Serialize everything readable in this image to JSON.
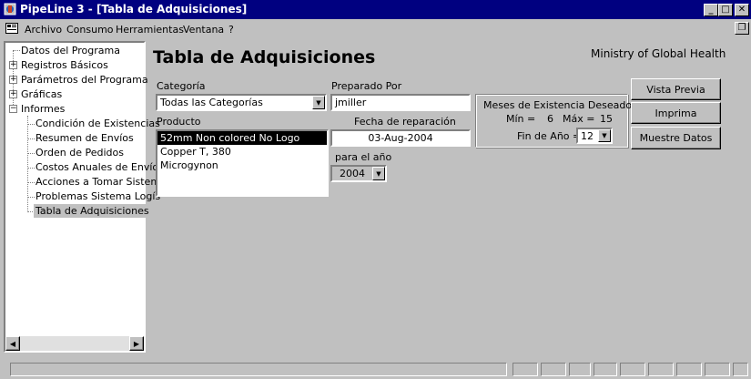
{
  "window": {
    "title": "PipeLine 3 - [Tabla de Adquisiciones]"
  },
  "menu": {
    "items": [
      "Archivo",
      "Consumo",
      "Herramientas",
      "Ventana",
      "?"
    ]
  },
  "tree": {
    "items": [
      {
        "label": "Datos del Programa",
        "expander": ""
      },
      {
        "label": "Registros Básicos",
        "expander": "+"
      },
      {
        "label": "Parámetros del Programa",
        "expander": "+"
      },
      {
        "label": "Gráficas",
        "expander": "+"
      },
      {
        "label": "Informes",
        "expander": "−"
      }
    ],
    "children": [
      "Condición de Existencias",
      "Resumen de Envíos",
      "Orden de Pedidos",
      "Costos Anuales de Envío",
      "Acciones a Tomar Sistema",
      "Problemas Sistema Logís",
      "Tabla de Adquisiciones"
    ],
    "selected_child_index": 6
  },
  "form": {
    "title": "Tabla de Adquisiciones",
    "org": "Ministry of Global Health",
    "category_label": "Categoría",
    "category_value": "Todas las Categorías",
    "prepared_label": "Preparado Por",
    "prepared_value": "jmiller",
    "product_label": "Producto",
    "products": [
      "52mm Non colored No Logo",
      "Copper T, 380",
      "Microgynon"
    ],
    "selected_product_index": 0,
    "date_label": "Fecha de reparación",
    "date_value": "03-Aug-2004",
    "year_label": "para el año",
    "year_value": "2004",
    "months": {
      "title": "Meses de Existencia Deseados",
      "min_label": "Mín =",
      "min_value": "6",
      "max_label": "Máx =",
      "max_value": "15",
      "year_end_label": "Fin de Año =",
      "year_end_value": "12"
    },
    "buttons": {
      "preview": "Vista Previa",
      "print": "Imprima",
      "show": "Muestre Datos"
    }
  },
  "colors": {
    "titlebar": "#000080",
    "selection": "#000080",
    "face": "#c0c0c0"
  }
}
